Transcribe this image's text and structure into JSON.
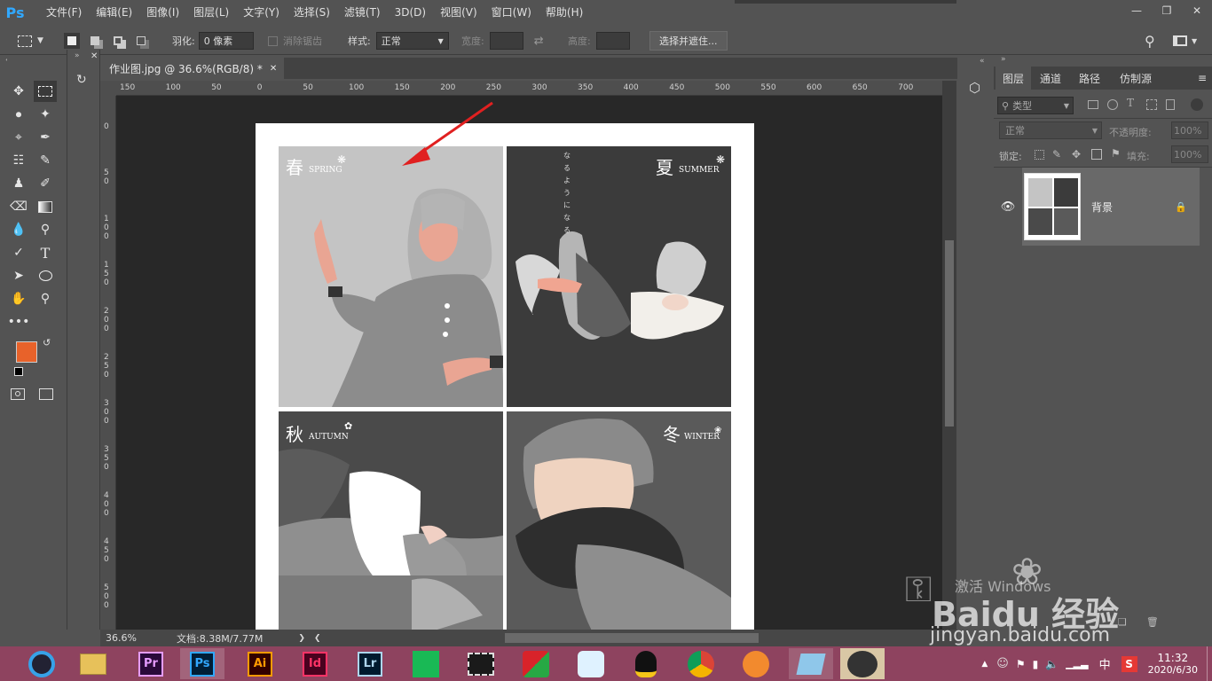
{
  "app": {
    "logo": "Ps"
  },
  "menu": [
    "文件(F)",
    "编辑(E)",
    "图像(I)",
    "图层(L)",
    "文字(Y)",
    "选择(S)",
    "滤镜(T)",
    "3D(D)",
    "视图(V)",
    "窗口(W)",
    "帮助(H)"
  ],
  "options": {
    "feather_label": "羽化:",
    "feather_value": "0 像素",
    "antialias_label": "消除锯齿",
    "style_label": "样式:",
    "style_value": "正常",
    "width_label": "宽度:",
    "height_label": "高度:",
    "select_mask_button": "选择并遮住..."
  },
  "document": {
    "tab_title": "作业图.jpg @ 36.6%(RGB/8) *",
    "ruler_h": [
      "150",
      "100",
      "50",
      "0",
      "50",
      "100",
      "150",
      "200",
      "250",
      "300",
      "350",
      "400",
      "450",
      "500",
      "550",
      "600",
      "650",
      "700"
    ],
    "ruler_v": [
      "0",
      "5 0",
      "1 0 0",
      "1 5 0",
      "2 0 0",
      "2 5 0",
      "3 0 0",
      "3 5 0",
      "4 0 0",
      "4 5 0",
      "5 0 0"
    ]
  },
  "artwork": {
    "spring_cn": "春",
    "spring_en": "SPRING",
    "summer_cn": "夏",
    "summer_en": "SUMMER",
    "summer_vertical": "なるようになる",
    "autumn_cn": "秋",
    "autumn_en": "AUTUMN",
    "winter_cn": "冬",
    "winter_en": "WINTER"
  },
  "status": {
    "zoom": "36.6%",
    "doc_size": "文档:8.38M/7.77M"
  },
  "layers_panel": {
    "tabs": [
      "图层",
      "通道",
      "路径",
      "仿制源"
    ],
    "filter_label": "类型",
    "blend_mode": "正常",
    "opacity_label": "不透明度:",
    "opacity_value": "100%",
    "lock_label": "锁定:",
    "fill_label": "填充:",
    "fill_value": "100%",
    "layers": [
      {
        "name": "背景"
      }
    ]
  },
  "colors": {
    "foreground": "#e8622a",
    "background": "#000000",
    "accent": "#31a8ff",
    "arrow": "#e02020"
  },
  "taskbar": {
    "apps": [
      "Pr",
      "Ps",
      "Ai",
      "Id",
      "Lr"
    ],
    "time": "11:32",
    "date": "2020/6/30",
    "ime": "中"
  },
  "watermark": {
    "line1": "激活 Windows",
    "brand": "Baidu 经验",
    "url": "jingyan.baidu.com"
  }
}
